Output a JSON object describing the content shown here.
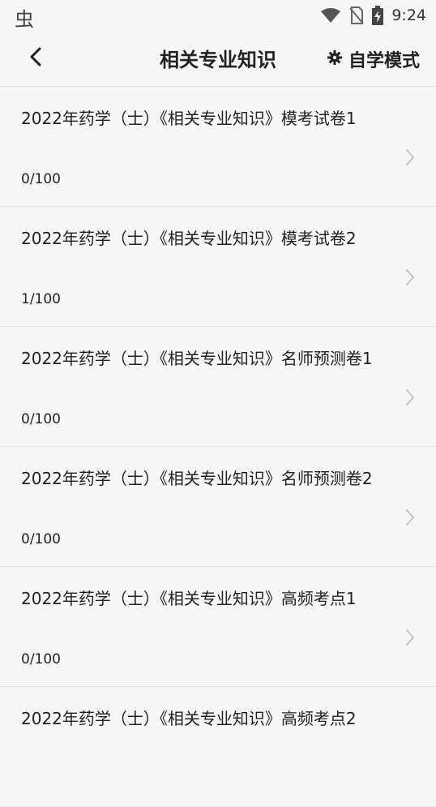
{
  "status_bar": {
    "left_glyph": "虫",
    "time": "9:24",
    "icons": [
      "wifi-icon",
      "no-sim-icon",
      "battery-charging-icon"
    ]
  },
  "app_bar": {
    "back_icon": "chevron-left-icon",
    "title": "相关专业知识",
    "mode_icon": "gear-icon",
    "mode_label": "自学模式"
  },
  "items": [
    {
      "title": "2022年药学（士）《相关专业知识》模考试卷1",
      "progress": "0/100"
    },
    {
      "title": "2022年药学（士）《相关专业知识》模考试卷2",
      "progress": "1/100"
    },
    {
      "title": "2022年药学（士）《相关专业知识》名师预测卷1",
      "progress": "0/100"
    },
    {
      "title": "2022年药学（士）《相关专业知识》名师预测卷2",
      "progress": "0/100"
    },
    {
      "title": "2022年药学（士）《相关专业知识》高频考点1",
      "progress": "0/100"
    },
    {
      "title": "2022年药学（士）《相关专业知识》高频考点2",
      "progress": ""
    }
  ]
}
